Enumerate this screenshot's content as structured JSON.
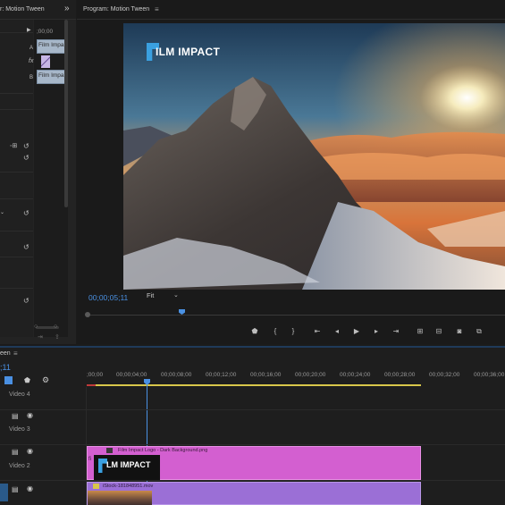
{
  "source_panel": {
    "tab_title": "r: Motion Tween",
    "expand_icon": "double-chevron-right-icon",
    "ruler_time": ";00;00",
    "track_a_label": "A",
    "track_b_label": "B",
    "fx_label": "fx",
    "clip_a_label": "Film Impa",
    "clip_b_label": "Film Impa"
  },
  "program_monitor": {
    "title": "Program: Motion Tween",
    "menu_icon": "hamburger-icon",
    "timecode": "00;00;05;11",
    "fit_value": "Fit",
    "logo_text": "ILM IMPACT",
    "transport_icons": [
      "marker-icon",
      "in-point-icon",
      "out-point-icon",
      "go-to-in-icon",
      "step-back-icon",
      "play-icon",
      "step-forward-icon",
      "go-to-out-icon",
      "insert-icon",
      "overwrite-icon",
      "export-frame-icon",
      "button-editor-icon"
    ]
  },
  "timeline": {
    "tab_title": "een",
    "timecode": ";11",
    "ruler_labels": [
      ";00;00",
      "00;00;04;00",
      "00;00;08;00",
      "00;00;12;00",
      "00;00;16;00",
      "00;00;20;00",
      "00;00;24;00",
      "00;00;28;00",
      "00;00;32;00",
      "00;00;36;00"
    ],
    "tracks": [
      {
        "name": "Video 4"
      },
      {
        "name": "Video 3"
      },
      {
        "name": "Video 2"
      },
      {
        "name": ""
      }
    ],
    "clip_v2_name": "Film Impact Logo - Dark Background.png",
    "clip_v2_logo": "LM IMPACT",
    "clip_v1_name": "iStock-181848951.mov"
  },
  "colors": {
    "accent_blue": "#4a90e2",
    "clip_pink": "#d35fd0",
    "clip_purple": "#9b6fd6",
    "work_area_yellow": "#d8c64a"
  }
}
